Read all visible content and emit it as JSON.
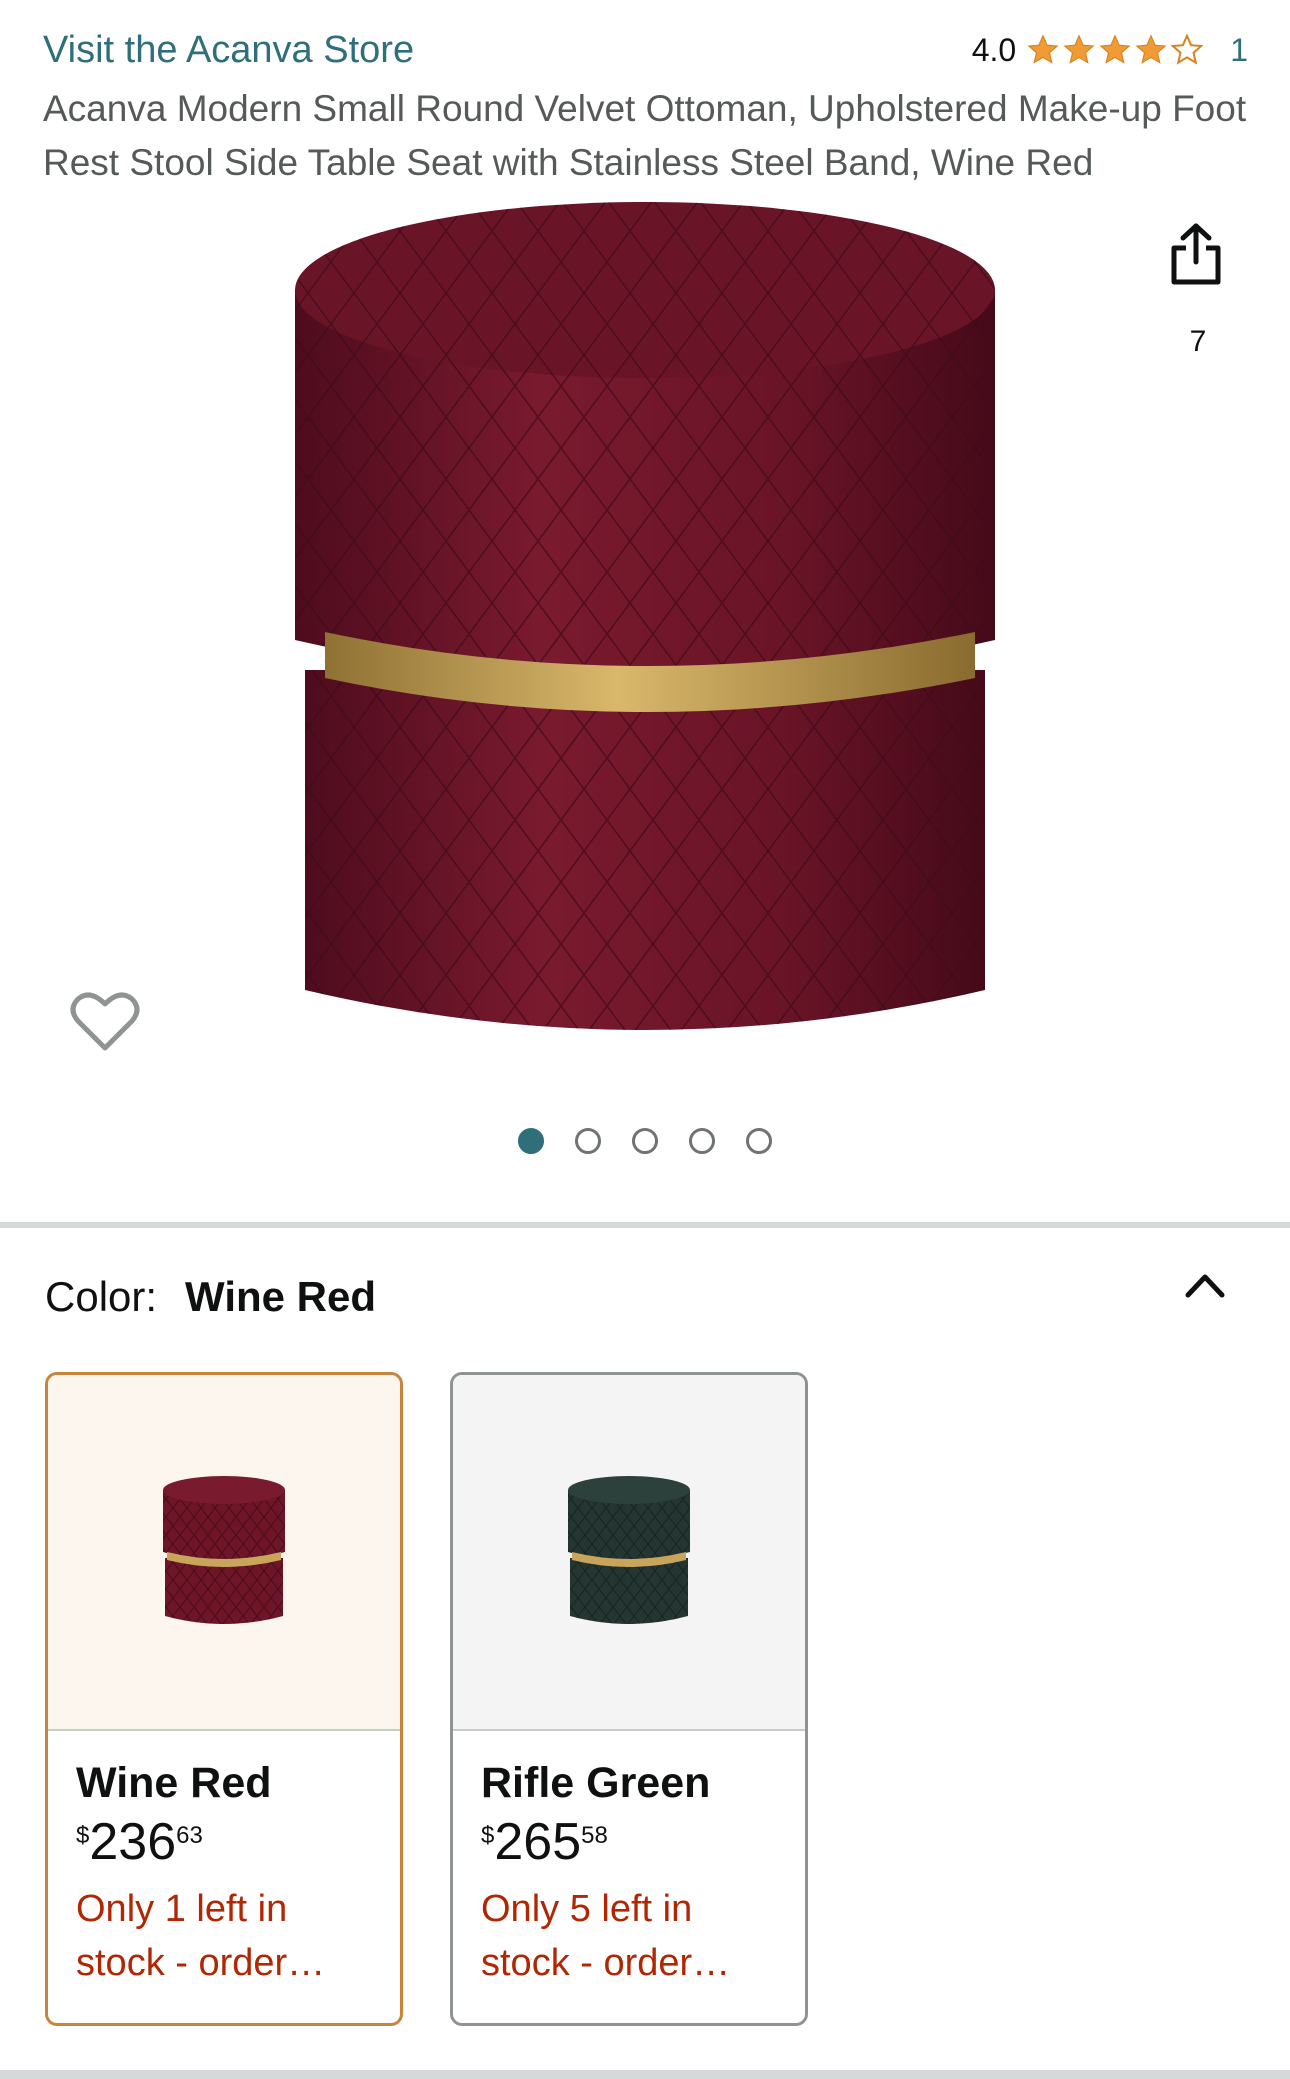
{
  "header": {
    "store_link": "Visit the Acanva Store",
    "rating_value": "4.0",
    "rating_stars": 4,
    "rating_count": "1",
    "product_title": "Acanva Modern Small Round Velvet Ottoman, Upholstered Make-up Foot Rest Stool Side Table Seat with Stainless Steel Band, Wine Red"
  },
  "gallery": {
    "image_count": "7",
    "total_dots": 5,
    "active_dot": 0,
    "share_icon": "share-icon",
    "favorite_icon": "heart-icon"
  },
  "color_selector": {
    "label": "Color:",
    "selected": "Wine Red",
    "collapse_icon": "chevron-up-icon",
    "options": [
      {
        "name": "Wine Red",
        "price_symbol": "$",
        "price_whole": "236",
        "price_fraction": "63",
        "stock": "Only 1 left in stock - order…",
        "swatch_color": "#6e1528"
      },
      {
        "name": "Rifle Green",
        "price_symbol": "$",
        "price_whole": "265",
        "price_fraction": "58",
        "stock": "Only 5 left in stock - order…",
        "swatch_color": "#243532"
      }
    ]
  },
  "colors": {
    "link": "#2f6f7a",
    "star": "#f09c36",
    "stock_alert": "#b12704",
    "selected_border": "#c7843b",
    "velvet_red": "#6e1528",
    "gold_band": "#c9a55c"
  }
}
